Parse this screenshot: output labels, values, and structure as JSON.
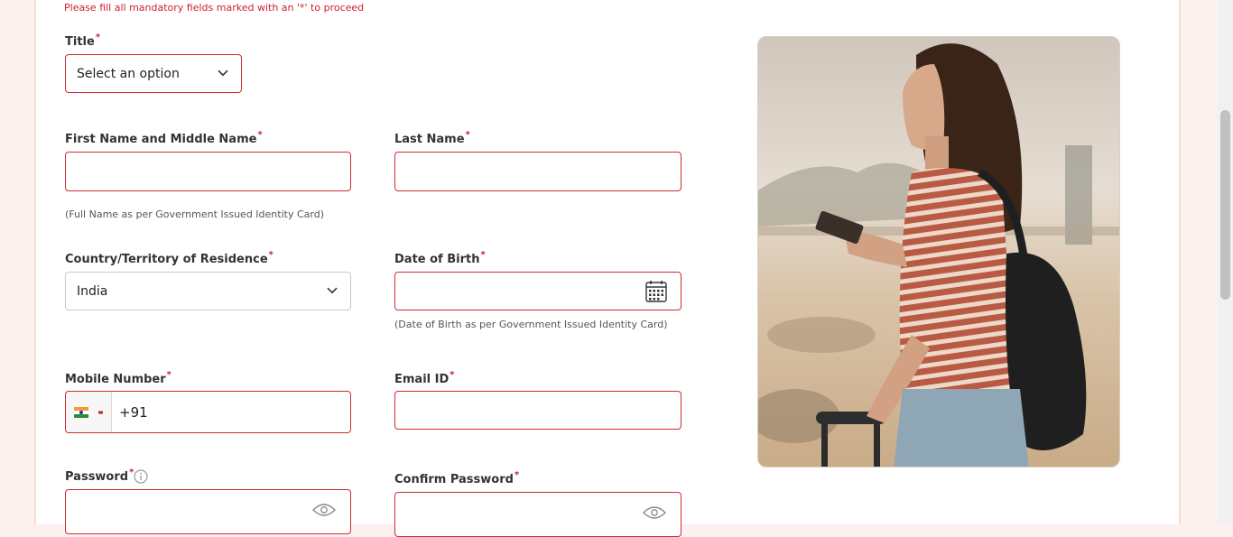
{
  "notice": "Please fill all mandatory fields marked with an '*' to proceed",
  "required_marker": "*",
  "fields": {
    "title": {
      "label": "Title",
      "value": "Select an option"
    },
    "first_name": {
      "label": "First Name and Middle Name",
      "value": ""
    },
    "last_name": {
      "label": "Last Name",
      "value": ""
    },
    "name_hint": "(Full Name as per Government Issued Identity Card)",
    "country": {
      "label": "Country/Territory of Residence",
      "value": "India"
    },
    "dob": {
      "label": "Date of Birth",
      "value": ""
    },
    "dob_hint": "(Date of Birth as per Government Issued Identity Card)",
    "mobile": {
      "label": "Mobile Number",
      "country_code": "+91",
      "flag": "india-flag-icon"
    },
    "email": {
      "label": "Email ID",
      "value": ""
    },
    "password": {
      "label": "Password",
      "value": ""
    },
    "confirm_password": {
      "label": "Confirm Password",
      "value": ""
    }
  },
  "colors": {
    "accent": "#cf2b36",
    "required": "#d0202e",
    "background": "#fdf1ef"
  }
}
